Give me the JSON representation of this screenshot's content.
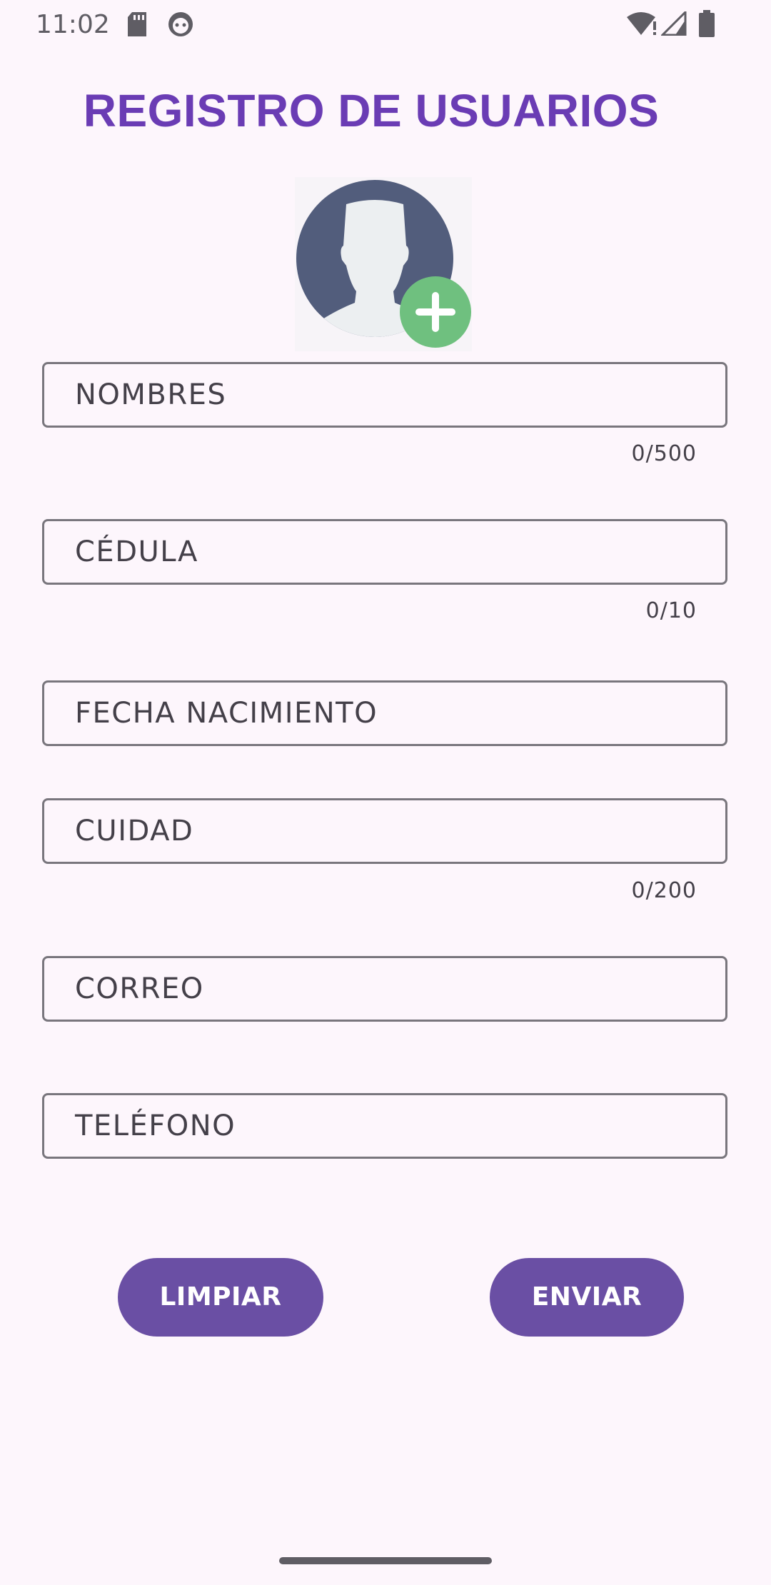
{
  "status_bar": {
    "time": "11:02",
    "left_icons": [
      "sd-card-icon",
      "android-face-icon"
    ],
    "right_icons": [
      "wifi-alert-icon",
      "cell-signal-icon",
      "battery-icon"
    ]
  },
  "page": {
    "title": "REGISTRO DE USUARIOS"
  },
  "avatar": {
    "icon": "user-silhouette-icon",
    "add_icon": "add-circle-icon",
    "colors": {
      "circle": "#525d7c",
      "silhouette": "#eceff1",
      "add": "#6fc07f"
    }
  },
  "form": {
    "fields": [
      {
        "label": "NOMBRES",
        "counter": "0/500"
      },
      {
        "label": "CÉDULA",
        "counter": "0/10"
      },
      {
        "label": "FECHA NACIMIENTO"
      },
      {
        "label": "CUIDAD",
        "counter": "0/200"
      },
      {
        "label": "CORREO"
      },
      {
        "label": "TELÉFONO"
      }
    ]
  },
  "actions": {
    "clear_label": "LIMPIAR",
    "submit_label": "ENVIAR"
  },
  "colors": {
    "background": "#fdf6fc",
    "title": "#6a3cb4",
    "button": "#6a4fa4"
  }
}
